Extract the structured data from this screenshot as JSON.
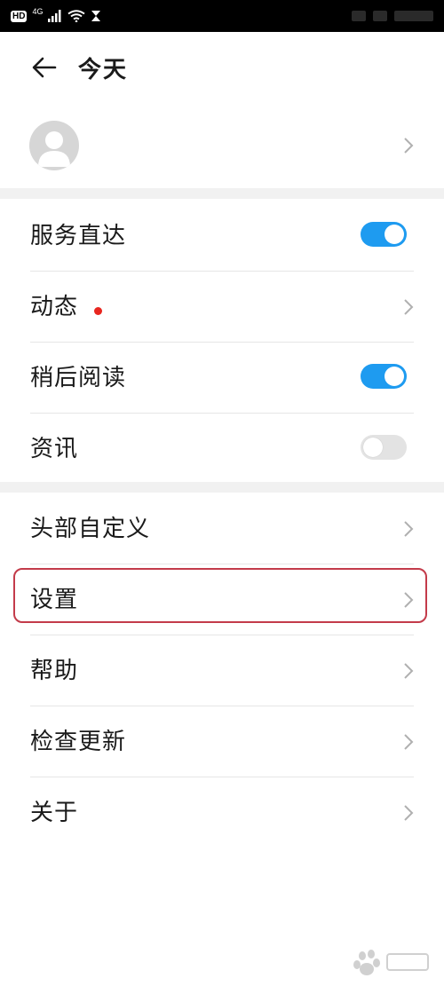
{
  "status_bar": {
    "hd_badge": "HD",
    "network": "4G"
  },
  "header": {
    "title": "今天"
  },
  "profile": {
    "name": ""
  },
  "section1": {
    "items": [
      {
        "label": "服务直达",
        "control": "toggle",
        "on": true
      },
      {
        "label": "动态",
        "control": "chevron",
        "dot": true
      },
      {
        "label": "稍后阅读",
        "control": "toggle",
        "on": true
      },
      {
        "label": "资讯",
        "control": "toggle",
        "on": false
      }
    ]
  },
  "section2": {
    "items": [
      {
        "label": "头部自定义",
        "control": "chevron"
      },
      {
        "label": "设置",
        "control": "chevron",
        "highlighted": true
      },
      {
        "label": "帮助",
        "control": "chevron"
      },
      {
        "label": "检查更新",
        "control": "chevron"
      },
      {
        "label": "关于",
        "control": "chevron"
      }
    ]
  },
  "colors": {
    "accent": "#1e9bf0",
    "highlight_border": "#c33b4a",
    "dot": "#e8261f"
  }
}
